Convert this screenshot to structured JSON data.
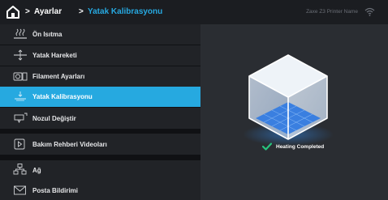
{
  "header": {
    "breadcrumb": [
      {
        "label": "Ayarlar"
      },
      {
        "label": "Yatak Kalibrasyonu"
      }
    ],
    "separator": ">",
    "printer_name": "Zaxe Z3 Printer Name",
    "icons": {
      "home": "home-icon",
      "wifi": "wifi-icon"
    }
  },
  "sidebar": {
    "items": [
      {
        "label": "Ön Isıtma",
        "icon": "preheat-icon",
        "selected": false
      },
      {
        "label": "Yatak Hareketi",
        "icon": "bed-move-icon",
        "selected": false
      },
      {
        "label": "Filament Ayarları",
        "icon": "filament-icon",
        "selected": false
      },
      {
        "label": "Yatak Kalibrasyonu",
        "icon": "calibration-icon",
        "selected": true
      },
      {
        "label": "Nozul Değiştir",
        "icon": "nozzle-icon",
        "selected": false
      },
      {
        "label": "Bakım Rehberi Videoları",
        "icon": "video-icon",
        "selected": false
      },
      {
        "label": "Ağ",
        "icon": "network-icon",
        "selected": false
      },
      {
        "label": "Posta Bildirimi",
        "icon": "mail-icon",
        "selected": false
      }
    ]
  },
  "main": {
    "status_text": "Heating Completed",
    "status_icon": "check-icon"
  },
  "colors": {
    "accent": "#26a9e0",
    "success": "#27c47e",
    "panel": "#2a2d32",
    "sidebar_item": "#212327"
  }
}
